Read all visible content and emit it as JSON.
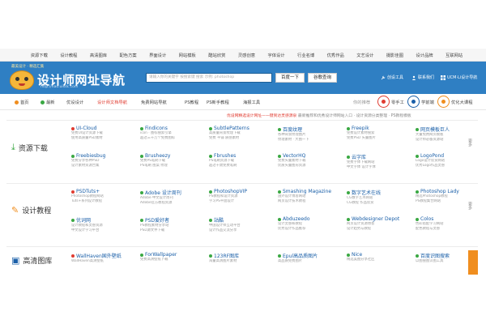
{
  "topnav": [
    "资源下载",
    "设计教程",
    "高清图库",
    "配色方案",
    "界面设计",
    "网站模板",
    "酷站欣赏",
    "灵感创意",
    "字体设计",
    "行业名博",
    "优秀作品",
    "文艺设计",
    "摄影佳图",
    "设计品牌",
    "互联网站"
  ],
  "header": {
    "logo_small": "最美设计 · 精选汇集",
    "logo_text": "设计师网址导航",
    "logo_url": "http://hao.uisdc.com",
    "search_placeholder": "请输入你的关键字 按搜索键 搜索 示例: photoshop",
    "btn_search": "百度一下",
    "btn_google": "谷歌查询",
    "links": [
      "创设工具",
      "联系我们",
      "UCM·Li设计导航"
    ]
  },
  "subbar": {
    "items": [
      "首页",
      "最新",
      "优设设计",
      "设计师文档导航",
      "免费网站导航",
      "PS教程",
      "PS新手教程",
      "海报工具"
    ],
    "right_label": "你的推荐",
    "rounds": [
      "零手工",
      "学前端",
      "优化大课程"
    ]
  },
  "notice": {
    "red": "优设网精选设计网址—一键到达灵感源泉",
    "gray": "最新推荐和优秀设计师网站入口 · 设计资源分类整理 · PS教程模板"
  },
  "sections": [
    {
      "title": "资源下载",
      "icon": "download-icon",
      "more": "更多",
      "columns": [
        [
          {
            "name": "UI-Cloud",
            "desc": [
              "免费UI设计资源下载",
              "使用高质量PSD素材"
            ]
          },
          {
            "name": "Freebiesbug",
            "desc": [
              "免费分享各种PSD",
              "设计素材资源合集"
            ]
          }
        ],
        [
          {
            "name": "Findicons",
            "desc": [
              "icon · 图标搜索引擎",
              "超过三十万个免费图标"
            ]
          },
          {
            "name": "Brusheezy",
            "desc": [
              "免费PS笔刷下载",
              "PS笔刷 图案 纹理"
            ]
          }
        ],
        [
          {
            "name": "SubtlePatterns",
            "desc": [
              "高质量背景纹理下载",
              "免费 平铺 质感素材"
            ]
          },
          {
            "name": "Fbrushes",
            "desc": [
              "PS笔刷资源下载",
              "超过千款免费笔刷"
            ]
          }
        ],
        [
          {
            "name": "百度纹理",
            "desc": [
              "各种背景纹理图片",
              "纹理素材 · 大图一下"
            ]
          },
          {
            "name": "VectorHQ",
            "desc": [
              "免费矢量素材下载",
              "优质矢量图形资源"
            ]
          }
        ],
        [
          {
            "name": "Freepik",
            "desc": [
              "免费设计素材搜索",
              "免费PSD 矢量图片"
            ]
          },
          {
            "name": "云字库",
            "desc": [
              "免费字体下载网站",
              "中文字体 设计字体"
            ]
          }
        ],
        [
          {
            "name": "网页模板巨人",
            "desc": [
              "大量免费网页模板",
              "设计师必备资源站"
            ]
          },
          {
            "name": "LogoPond",
            "desc": [
              "Logo设计欣赏网站",
              "优秀Logo作品灵感"
            ]
          }
        ]
      ]
    },
    {
      "title": "设计教程",
      "icon": "tools-icon",
      "more": "更多",
      "columns": [
        [
          {
            "name": "PSDTuts+",
            "desc": [
              "Photoshop教程网站",
              "Tuts+系列设计教程"
            ]
          },
          {
            "name": "优词网",
            "desc": [
              "设计教程和灵感资源",
              "中文设计学习平台"
            ]
          }
        ],
        [
          {
            "name": "Adobe 设计周刊",
            "desc": [
              "Adobe 中文设计周刊",
              "Adobe官方教程资源"
            ]
          },
          {
            "name": "PSD爱好者",
            "desc": [
              "PS教程素材分享站",
              "PSD源文件下载"
            ]
          }
        ],
        [
          {
            "name": "PhotoshopVIP",
            "desc": [
              "PS教程和设计资源",
              "学习PS平面设计"
            ]
          },
          {
            "name": "站酷",
            "desc": [
              "中国设计师互动平台",
              "设计作品交流分享"
            ]
          }
        ],
        [
          {
            "name": "Smashing Magazine",
            "desc": [
              "国外设计博客网站",
              "网页设计技术教程"
            ]
          },
          {
            "name": "Abduzeedo",
            "desc": [
              "设计灵感和教程",
              "优秀设计作品推荐"
            ]
          }
        ],
        [
          {
            "name": "数字艺术在线",
            "desc": [
              "CG数字艺术网站",
              "CG教程 作品欣赏"
            ]
          },
          {
            "name": "Webdesigner Depot",
            "desc": [
              "网页设计资源博客",
              "设计趋势与教程"
            ]
          }
        ],
        [
          {
            "name": "Photoshop Lady",
            "desc": [
              "精选Photoshop教程",
              "PS教程集合网站"
            ]
          },
          {
            "name": "Colos",
            "desc": [
              "色彩搭配学习网站",
              "配色教程与灵感"
            ]
          }
        ]
      ]
    },
    {
      "title": "高清图库",
      "icon": "image-icon",
      "more": "",
      "columns": [
        [
          {
            "name": "WallHaven国外壁纸",
            "desc": [
              "WallHaven高清壁纸"
            ]
          }
        ],
        [
          {
            "name": "ForWallpaper",
            "desc": [
              "免费高清壁纸下载"
            ]
          }
        ],
        [
          {
            "name": "123RF图库",
            "desc": [
              "海量高清图片素材"
            ]
          }
        ],
        [
          {
            "name": "Epul高品质图片",
            "desc": [
              "高品质免费图片"
            ]
          }
        ],
        [
          {
            "name": "Nice",
            "desc": [
              "精选美图分享社区"
            ]
          }
        ],
        [
          {
            "name": "百度识图搜索",
            "desc": [
              "以图搜图识图工具"
            ]
          }
        ]
      ]
    }
  ],
  "colors": {
    "header_blue": "#2f7fc3",
    "link_blue": "#1a5fa8",
    "accent_red": "#e03c31",
    "accent_orange": "#f08e1f",
    "green": "#3aa843"
  }
}
